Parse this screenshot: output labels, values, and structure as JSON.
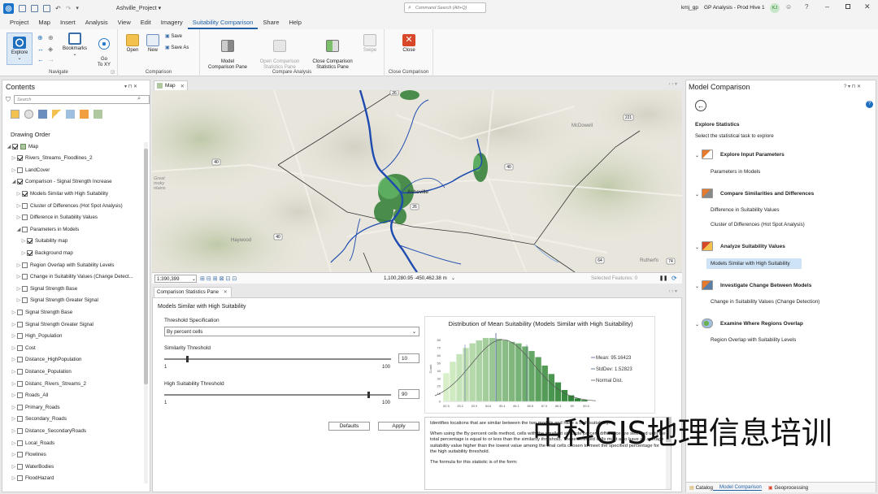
{
  "titlebar": {
    "project": "Ashville_Project ▾",
    "search_placeholder": "Command Search (Alt+Q)",
    "file": "kmj_gp",
    "app": "GP Analysis - Prod Hive 1",
    "user": "KJ"
  },
  "tabs": [
    "Project",
    "Map",
    "Insert",
    "Analysis",
    "View",
    "Edit",
    "Imagery",
    "Suitability Comparison",
    "Share",
    "Help"
  ],
  "ribbon": {
    "navigate": {
      "label": "Navigate",
      "explore": "Explore",
      "bookmarks": "Bookmarks",
      "goto": "Go\nTo XY"
    },
    "comparison": {
      "label": "Comparison",
      "open": "Open",
      "new": "New",
      "save": "Save",
      "save_as": "Save As"
    },
    "model_analysis": {
      "label": "Compare Analysis",
      "model_pane": "Model\nComparison Pane",
      "open_stats": "Open Comparison\nStatistics Pane",
      "close_stats": "Close Comparison\nStatistics Pane",
      "swipe": "Swipe"
    },
    "close_group": {
      "label": "Close Comparison",
      "close": "Close"
    }
  },
  "contents": {
    "title": "Contents",
    "search_placeholder": "Search",
    "drawing_order": "Drawing Order",
    "layers": [
      {
        "label": "Map",
        "level": 0,
        "checked": true,
        "tri": "◢"
      },
      {
        "label": "Rivers_Streams_Floodlines_2",
        "level": 1,
        "checked": true,
        "tri": "▷"
      },
      {
        "label": "LandCover",
        "level": 1,
        "checked": false,
        "tri": "▷"
      },
      {
        "label": "Comparison - Signal Strength Increase",
        "level": 1,
        "checked": true,
        "tri": "◢"
      },
      {
        "label": "Models Similar with High Suitability",
        "level": 2,
        "checked": true,
        "tri": "▷"
      },
      {
        "label": "Cluster of Differences (Hot Spot Analysis)",
        "level": 2,
        "checked": false,
        "tri": "▷"
      },
      {
        "label": "Difference in Suitability Values",
        "level": 2,
        "checked": false,
        "tri": "▷"
      },
      {
        "label": "Parameters in Models",
        "level": 2,
        "checked": false,
        "tri": "◢"
      },
      {
        "label": "Suitability map",
        "level": 3,
        "checked": true,
        "tri": "▷"
      },
      {
        "label": "Background map",
        "level": 3,
        "checked": true,
        "tri": "▷"
      },
      {
        "label": "Region Overlap with Suitability Levels",
        "level": 2,
        "checked": false,
        "tri": "▷"
      },
      {
        "label": "Change in Suitability Values (Change Detect...",
        "level": 2,
        "checked": false,
        "tri": "▷"
      },
      {
        "label": "Signal Strength Base",
        "level": 2,
        "checked": false,
        "tri": "▷"
      },
      {
        "label": "Signal Strength Greater Signal",
        "level": 2,
        "checked": false,
        "tri": "▷"
      },
      {
        "label": "Signal Strength Base",
        "level": 1,
        "checked": false,
        "tri": "▷"
      },
      {
        "label": "Signal Strength Greater Signal",
        "level": 1,
        "checked": false,
        "tri": "▷"
      },
      {
        "label": "High_Population",
        "level": 1,
        "checked": false,
        "tri": "▷"
      },
      {
        "label": "Cost",
        "level": 1,
        "checked": false,
        "tri": "▷"
      },
      {
        "label": "Distance_HighPopulation",
        "level": 1,
        "checked": false,
        "tri": "▷"
      },
      {
        "label": "Distance_Population",
        "level": 1,
        "checked": false,
        "tri": "▷"
      },
      {
        "label": "Distanc_Rivers_Streams_2",
        "level": 1,
        "checked": false,
        "tri": "▷"
      },
      {
        "label": "Roads_All",
        "level": 1,
        "checked": false,
        "tri": "▷"
      },
      {
        "label": "Primary_Roads",
        "level": 1,
        "checked": false,
        "tri": "▷"
      },
      {
        "label": "Secondary_Roads",
        "level": 1,
        "checked": false,
        "tri": "▷"
      },
      {
        "label": "Distance_SecondaryRoads",
        "level": 1,
        "checked": false,
        "tri": "▷"
      },
      {
        "label": "Local_Roads",
        "level": 1,
        "checked": false,
        "tri": "▷"
      },
      {
        "label": "Flowlines",
        "level": 1,
        "checked": false,
        "tri": "▷"
      },
      {
        "label": "WaterBodies",
        "level": 1,
        "checked": false,
        "tri": "▷"
      },
      {
        "label": "FloodHazard",
        "level": 1,
        "checked": false,
        "tri": "▷"
      }
    ]
  },
  "map": {
    "tab": "Map",
    "labels": {
      "asheville": "Asheville",
      "mcdowell": "McDowell",
      "haywood": "Haywood",
      "rutherford": "Rutherfo",
      "great_smoky": "Great\nmoky\nntains"
    },
    "route_shields": [
      "26",
      "40",
      "40",
      "40",
      "221",
      "64",
      "74",
      "26"
    ],
    "scale": "1:390,399",
    "coords": "1,100,280.95 -450,462.38 m",
    "selected": "Selected Features: 0"
  },
  "stats": {
    "tab": "Comparison Statistics Pane",
    "heading": "Models Similar with High Suitability",
    "threshold_spec_label": "Threshold Specification",
    "threshold_spec_value": "By percent cells",
    "similarity_label": "Similarity Threshold",
    "similarity_value": "10",
    "similarity_min": "1",
    "similarity_max": "100",
    "similarity_level": 0.1,
    "high_label": "High Suitability Threshold",
    "high_value": "90",
    "high_min": "1",
    "high_max": "100",
    "high_level": 0.9,
    "defaults": "Defaults",
    "apply": "Apply",
    "desc_1": "Identifies locations that are similar between the two models and have a high suitability.",
    "desc_2": "When using the By percent cells method, cells with the smallest absolute percent difference are selected until the total percentage is equal to or less than the similarity threshold. These selected cells must also have an average suitability value higher than the lowest value among the final cells chosen to meet the specified percentage for the high suitability threshold.",
    "desc_3": "The formula for this statistic is of the form:"
  },
  "chart_data": {
    "type": "bar",
    "title": "Distribution of Mean Suitability (Models Similar with High Suitability)",
    "ylabel": "Count",
    "xlabel": "",
    "ylim": [
      0,
      85
    ],
    "yticks": [
      0,
      10,
      20,
      30,
      40,
      50,
      60,
      70,
      80
    ],
    "xticks": [
      "82.5",
      "83.2",
      "83.9",
      "84.6",
      "85.4",
      "86.1",
      "86.8",
      "87.5",
      "88.3",
      "89",
      "89.6"
    ],
    "values": [
      37,
      52,
      62,
      70,
      76,
      80,
      83,
      83,
      82,
      80,
      78,
      76,
      72,
      66,
      58,
      47,
      36,
      25,
      15,
      8,
      4,
      2
    ],
    "mean_bin": 11,
    "legend": [
      {
        "label": "Mean: 95.16423"
      },
      {
        "label": "StdDev: 1.52823"
      },
      {
        "label": "Normal Dist."
      }
    ],
    "colors": {
      "light": "#d8efc9",
      "dark": "#1f7a2a",
      "mean": "#4a5e9a",
      "curve": "#555555"
    }
  },
  "model_comparison": {
    "title": "Model Comparison",
    "heading": "Explore Statistics",
    "subheading": "Select the statistical task to explore",
    "groups": [
      {
        "title": "Explore Input Parameters",
        "items": [
          "Parameters in Models"
        ]
      },
      {
        "title": "Compare Similarities and Differences",
        "items": [
          "Difference in Suitability Values",
          "Cluster of Differences (Hot Spot Analysis)"
        ]
      },
      {
        "title": "Analyze Suitability Values",
        "items": [
          "Models Similar with High Suitability"
        ]
      },
      {
        "title": "Investigate Change Between Models",
        "items": [
          "Change in Suitability Values (Change Detection)"
        ]
      },
      {
        "title": "Examine Where Regions Overlap",
        "items": [
          "Region Overlap with Suitability Levels"
        ]
      }
    ],
    "selected_item": "Models Similar with High Suitability",
    "bottom_tabs": [
      "Catalog",
      "Model Comparison",
      "Geoprocessing"
    ]
  },
  "watermark": "中科GIS地理信息培训"
}
